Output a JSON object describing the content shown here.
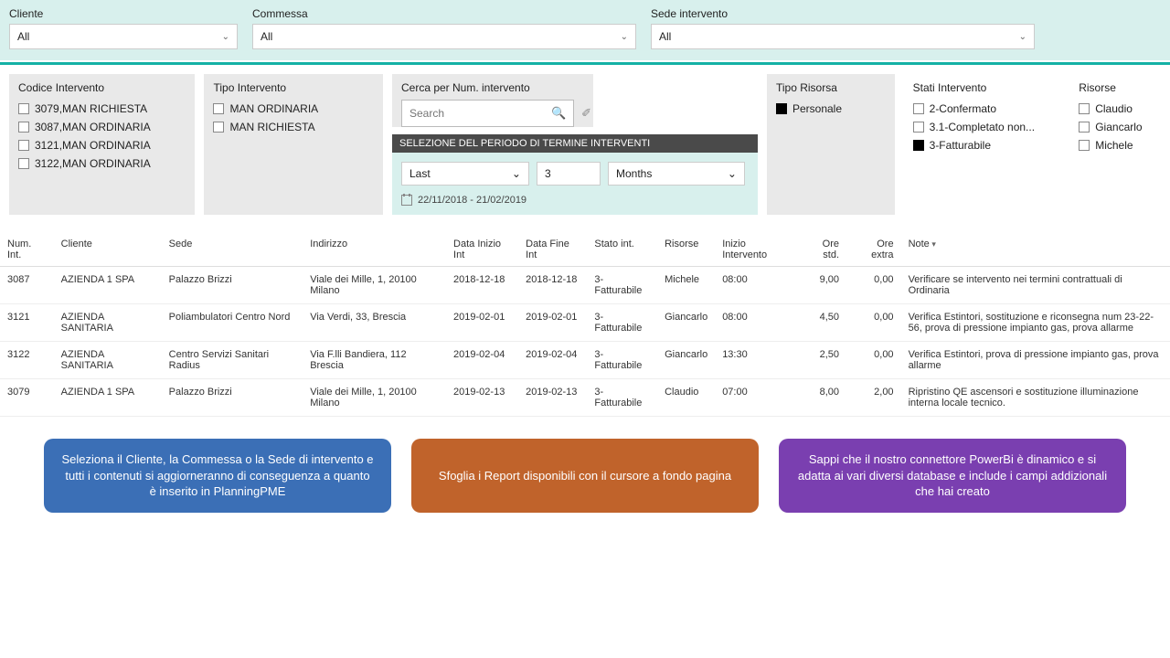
{
  "topFilters": {
    "cliente": {
      "label": "Cliente",
      "value": "All"
    },
    "commessa": {
      "label": "Commessa",
      "value": "All"
    },
    "sede": {
      "label": "Sede intervento",
      "value": "All"
    }
  },
  "codiceIntervento": {
    "title": "Codice Intervento",
    "items": [
      "3079,MAN RICHIESTA",
      "3087,MAN ORDINARIA",
      "3121,MAN ORDINARIA",
      "3122,MAN ORDINARIA"
    ]
  },
  "tipoIntervento": {
    "title": "Tipo Intervento",
    "items": [
      "MAN ORDINARIA",
      "MAN RICHIESTA"
    ]
  },
  "search": {
    "title": "Cerca per Num. intervento",
    "placeholder": "Search"
  },
  "tipoRisorsa": {
    "title": "Tipo Risorsa",
    "items": [
      {
        "label": "Personale",
        "checked": true
      }
    ]
  },
  "statiIntervento": {
    "title": "Stati Intervento",
    "items": [
      {
        "label": "2-Confermato",
        "checked": false
      },
      {
        "label": "3.1-Completato non...",
        "checked": false
      },
      {
        "label": "3-Fatturabile",
        "checked": true
      }
    ]
  },
  "risorse": {
    "title": "Risorse",
    "items": [
      "Claudio",
      "Giancarlo",
      "Michele"
    ]
  },
  "period": {
    "header": "SELEZIONE DEL PERIODO DI TERMINE INTERVENTI",
    "mode": "Last",
    "count": "3",
    "unit": "Months",
    "range": "22/11/2018 - 21/02/2019"
  },
  "table": {
    "headers": [
      "Num. Int.",
      "Cliente",
      "Sede",
      "Indirizzo",
      "Data Inizio Int",
      "Data Fine Int",
      "Stato int.",
      "Risorse",
      "Inizio Intervento",
      "Ore std.",
      "Ore extra",
      "Note"
    ],
    "rows": [
      {
        "num": "3087",
        "cliente": "AZIENDA 1 SPA",
        "sede": "Palazzo Brizzi",
        "indirizzo": "Viale dei Mille, 1, 20100 Milano",
        "di": "2018-12-18",
        "df": "2018-12-18",
        "stato": "3-Fatturabile",
        "ris": "Michele",
        "inizio": "08:00",
        "std": "9,00",
        "extra": "0,00",
        "note": "Verificare se intervento nei termini contrattuali di Ordinaria"
      },
      {
        "num": "3121",
        "cliente": "AZIENDA SANITARIA",
        "sede": "Poliambulatori Centro Nord",
        "indirizzo": "Via Verdi, 33, Brescia",
        "di": "2019-02-01",
        "df": "2019-02-01",
        "stato": "3-Fatturabile",
        "ris": "Giancarlo",
        "inizio": "08:00",
        "std": "4,50",
        "extra": "0,00",
        "note": "Verifica Estintori, sostituzione e riconsegna num 23-22-56, prova di pressione impianto gas, prova allarme"
      },
      {
        "num": "3122",
        "cliente": "AZIENDA SANITARIA",
        "sede": "Centro Servizi Sanitari Radius",
        "indirizzo": "Via F.lli Bandiera, 112 Brescia",
        "di": "2019-02-04",
        "df": "2019-02-04",
        "stato": "3-Fatturabile",
        "ris": "Giancarlo",
        "inizio": "13:30",
        "std": "2,50",
        "extra": "0,00",
        "note": "Verifica Estintori, prova di pressione impianto gas, prova allarme"
      },
      {
        "num": "3079",
        "cliente": "AZIENDA 1 SPA",
        "sede": "Palazzo Brizzi",
        "indirizzo": "Viale dei Mille, 1, 20100 Milano",
        "di": "2019-02-13",
        "df": "2019-02-13",
        "stato": "3-Fatturabile",
        "ris": "Claudio",
        "inizio": "07:00",
        "std": "8,00",
        "extra": "2,00",
        "note": "Ripristino QE ascensori e sostituzione illuminazione interna locale tecnico."
      }
    ]
  },
  "callouts": {
    "blue": "Seleziona il Cliente, la Commessa o la Sede di intervento e tutti i contenuti si aggiorneranno di conseguenza a quanto è inserito in PlanningPME",
    "orange": "Sfoglia i Report disponibili con il cursore a fondo pagina",
    "purple": "Sappi che il nostro connettore PowerBi è dinamico e si adatta ai vari diversi database e include i campi addizionali che hai creato"
  }
}
